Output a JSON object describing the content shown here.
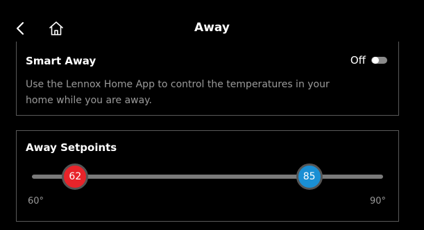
{
  "header": {
    "title": "Away",
    "back_icon": "chevron-left-icon",
    "home_icon": "home-icon"
  },
  "smart_away": {
    "title": "Smart Away",
    "toggle_label": "Off",
    "toggle_state": false,
    "description": "Use the Lennox Home App to control the temperatures in your home while you are away."
  },
  "away_setpoints": {
    "title": "Away Setpoints",
    "min_label": "60°",
    "max_label": "90°",
    "range_min": 60,
    "range_max": 90,
    "heat_value": "62",
    "cool_value": "85",
    "heat_color": "#e8242a",
    "cool_color": "#1a8fd4"
  }
}
